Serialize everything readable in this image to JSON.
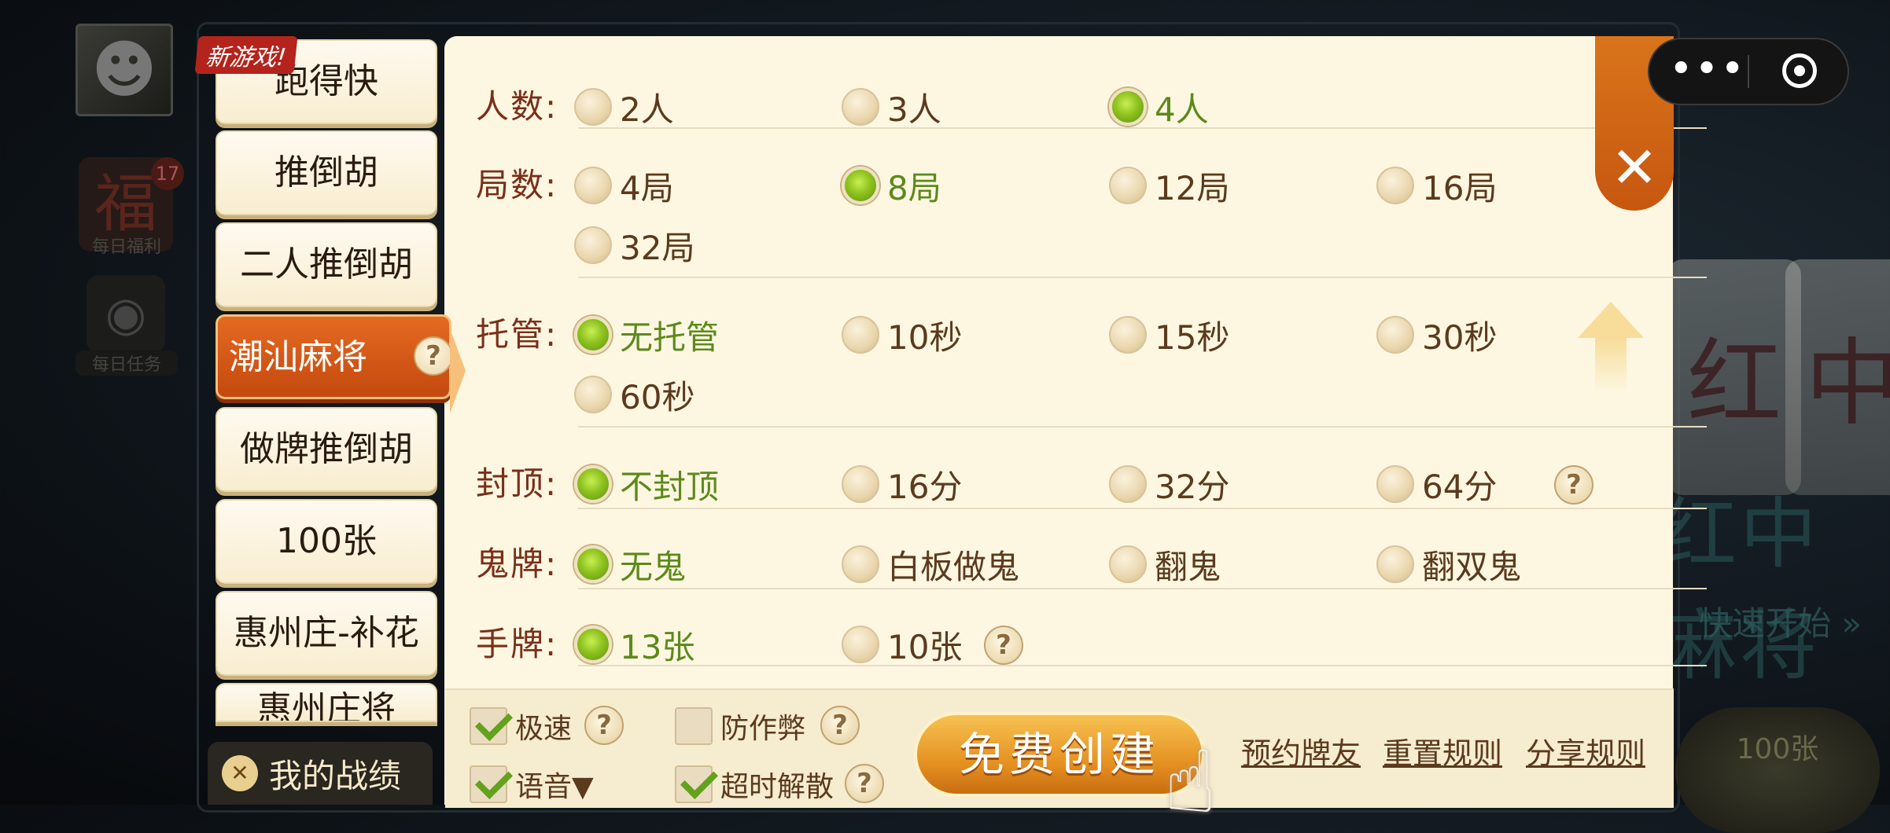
{
  "background": {
    "avatar_glyph": "☻",
    "fu_glyph": "福",
    "fu_badge": "17",
    "fu_caption": "每日福利",
    "bag_glyph": "◉",
    "bag_caption": "每日任务",
    "tile_glyph_1": "红",
    "tile_glyph_2": "中",
    "game_title": "红中麻将",
    "quick_start": "快速开始 »",
    "badge_100": "100张"
  },
  "menu": {
    "new_badge": "新游戏!",
    "items": [
      {
        "label": "跑得快"
      },
      {
        "label": "推倒胡"
      },
      {
        "label": "二人推倒胡"
      },
      {
        "label": "潮汕麻将"
      },
      {
        "label": "做牌推倒胡"
      },
      {
        "label": "100张"
      },
      {
        "label": "惠州庄-补花"
      },
      {
        "label": "惠州庄将"
      }
    ],
    "active_help": "?",
    "record_icon": "✕",
    "record_label": "我的战绩"
  },
  "rules": {
    "players": {
      "label": "人数:",
      "options": [
        "2人",
        "3人",
        "4人"
      ],
      "selected": "4人"
    },
    "rounds": {
      "label": "局数:",
      "options": [
        "4局",
        "8局",
        "12局",
        "16局",
        "32局"
      ],
      "selected": "8局"
    },
    "hosting": {
      "label": "托管:",
      "options": [
        "无托管",
        "10秒",
        "15秒",
        "30秒",
        "60秒"
      ],
      "selected": "无托管"
    },
    "cap": {
      "label": "封顶:",
      "options": [
        "不封顶",
        "16分",
        "32分",
        "64分"
      ],
      "selected": "不封顶",
      "help": "?"
    },
    "ghost": {
      "label": "鬼牌:",
      "options": [
        "无鬼",
        "白板做鬼",
        "翻鬼",
        "翻双鬼"
      ],
      "selected": "无鬼"
    },
    "hand": {
      "label": "手牌:",
      "options": [
        "13张",
        "10张"
      ],
      "selected": "13张",
      "help": "?"
    }
  },
  "bottom": {
    "speed": {
      "label": "极速",
      "checked": true,
      "help": "?"
    },
    "anticheat": {
      "label": "防作弊",
      "checked": false,
      "help": "?"
    },
    "voice": {
      "label": "语音▼",
      "checked": true
    },
    "timeout": {
      "label": "超时解散",
      "checked": true,
      "help": "?"
    },
    "create_button": "免费创建",
    "hand_glyph": "☝",
    "links": [
      "预约牌友",
      "重置规则",
      "分享规则"
    ]
  },
  "close_label": "✕",
  "capsule": {
    "more": "•••"
  }
}
